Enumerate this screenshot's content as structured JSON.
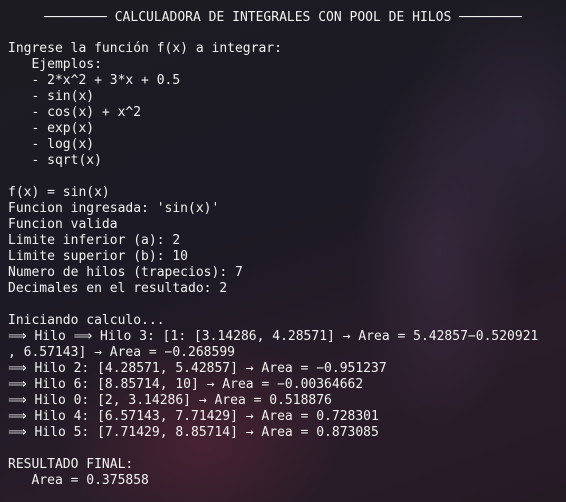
{
  "terminal": {
    "lines": [
      "Ingrese la función f(x) a integrar:",
      "   Ejemplos:",
      "   - 2*x^2 + 3*x + 0.5",
      "   - sin(x)",
      "   - cos(x) + x^2",
      "   - exp(x)",
      "   - log(x)",
      "   - sqrt(x)",
      "",
      "f(x) = sin(x)",
      "Funcion ingresada: 'sin(x)'",
      "Funcion valida",
      "Limite inferior (a): 2",
      "Limite superior (b): 10",
      "Numero de hilos (trapecios): 7",
      "Decimales en el resultado: 2",
      "",
      "Iniciando calculo...",
      "⟹ Hilo ⟹ Hilo 3: [1: [3.14286, 4.28571] → Area = 5.42857−0.520921",
      ", 6.57143] → Area = −0.268599",
      "⟹ Hilo 2: [4.28571, 5.42857] → Area = −0.951237",
      "⟹ Hilo 6: [8.85714, 10] → Area = −0.00364662",
      "⟹ Hilo 0: [2, 3.14286] → Area = 0.518876",
      "⟹ Hilo 4: [6.57143, 7.71429] → Area = 0.728301",
      "⟹ Hilo 5: [7.71429, 8.85714] → Area = 0.873085",
      "",
      "RESULTADO FINAL:",
      "   Area = 0.375858"
    ],
    "banner": "──────── CALCULADORA DE INTEGRALES CON POOL DE HILOS ────────"
  }
}
